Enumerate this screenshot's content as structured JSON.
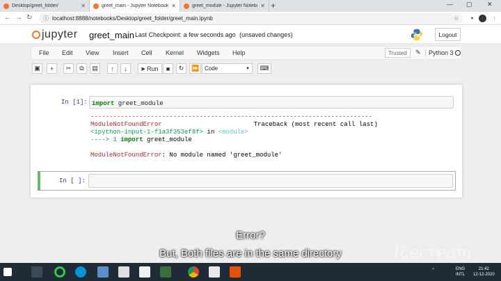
{
  "browser": {
    "tabs": [
      {
        "title": "Desktop/greet_folder/"
      },
      {
        "title": "greet_main - Jupyter Notebook"
      },
      {
        "title": "greet_module - Jupyter Notebo..."
      }
    ],
    "new_tab": "+",
    "url": "localhost:8888/notebooks/Desktop/greet_folder/greet_main.ipynb",
    "min": "—",
    "max": "▢",
    "close": "✕"
  },
  "jupyter": {
    "logo_text": "jupyter",
    "notebook_name": "greet_main",
    "checkpoint_label": "Last Checkpoint:",
    "checkpoint_time": "a few seconds ago",
    "unsaved": "(unsaved changes)",
    "logout": "Logout"
  },
  "menu": {
    "items": [
      "File",
      "Edit",
      "View",
      "Insert",
      "Cell",
      "Kernel",
      "Widgets",
      "Help"
    ],
    "trusted": "Trusted",
    "kernel": "Python 3"
  },
  "toolbar": {
    "run": "Run",
    "cell_type": "Code"
  },
  "cells": [
    {
      "prompt": "In [1]:",
      "kw": "import",
      "rest": " greet_module",
      "output": {
        "dashes": "---------------------------------------------------------------------------",
        "err_name": "ModuleNotFoundError",
        "traceback_label": "Traceback (most recent call last)",
        "ipy_input": "<ipython-input-1-f1a3f353ef8f>",
        "in_word": " in ",
        "module_tag": "<module>",
        "arrow_line": "----> 1 ",
        "arrow_kw": "import",
        "arrow_rest": " greet_module",
        "err_msg": ": No module named 'greet_module'"
      }
    },
    {
      "prompt": "In [ ]:"
    }
  ],
  "overlay": {
    "caption1": "Error?",
    "caption2": "But, Both files are in the same directory",
    "watermark": "Icecream"
  },
  "tray": {
    "lang1": "ENG",
    "lang2": "INTL",
    "time": "21:42",
    "date": "12-12-2020"
  }
}
